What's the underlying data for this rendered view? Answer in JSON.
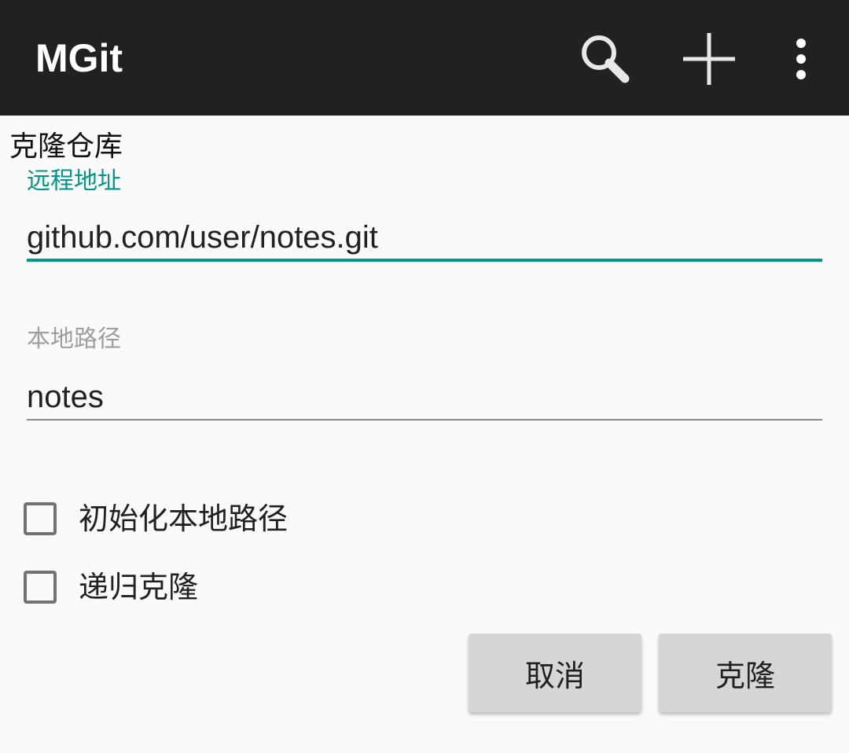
{
  "app_bar": {
    "title": "MGit",
    "actions": [
      {
        "icon": "search-icon"
      },
      {
        "icon": "add-icon"
      },
      {
        "icon": "more-vert-icon"
      }
    ],
    "background": "#212121"
  },
  "dialog": {
    "title": "克隆仓库",
    "remote": {
      "label": "远程地址",
      "value": "github.com/user/notes.git"
    },
    "local": {
      "label": "本地路径",
      "value": "notes"
    },
    "options": [
      {
        "label": "初始化本地路径",
        "checked": false
      },
      {
        "label": "递归克隆",
        "checked": false
      }
    ],
    "buttons": {
      "cancel": "取消",
      "clone": "克隆"
    }
  },
  "colors": {
    "accent": "#009688",
    "text": "#212121",
    "hint": "#9e9e9e"
  }
}
